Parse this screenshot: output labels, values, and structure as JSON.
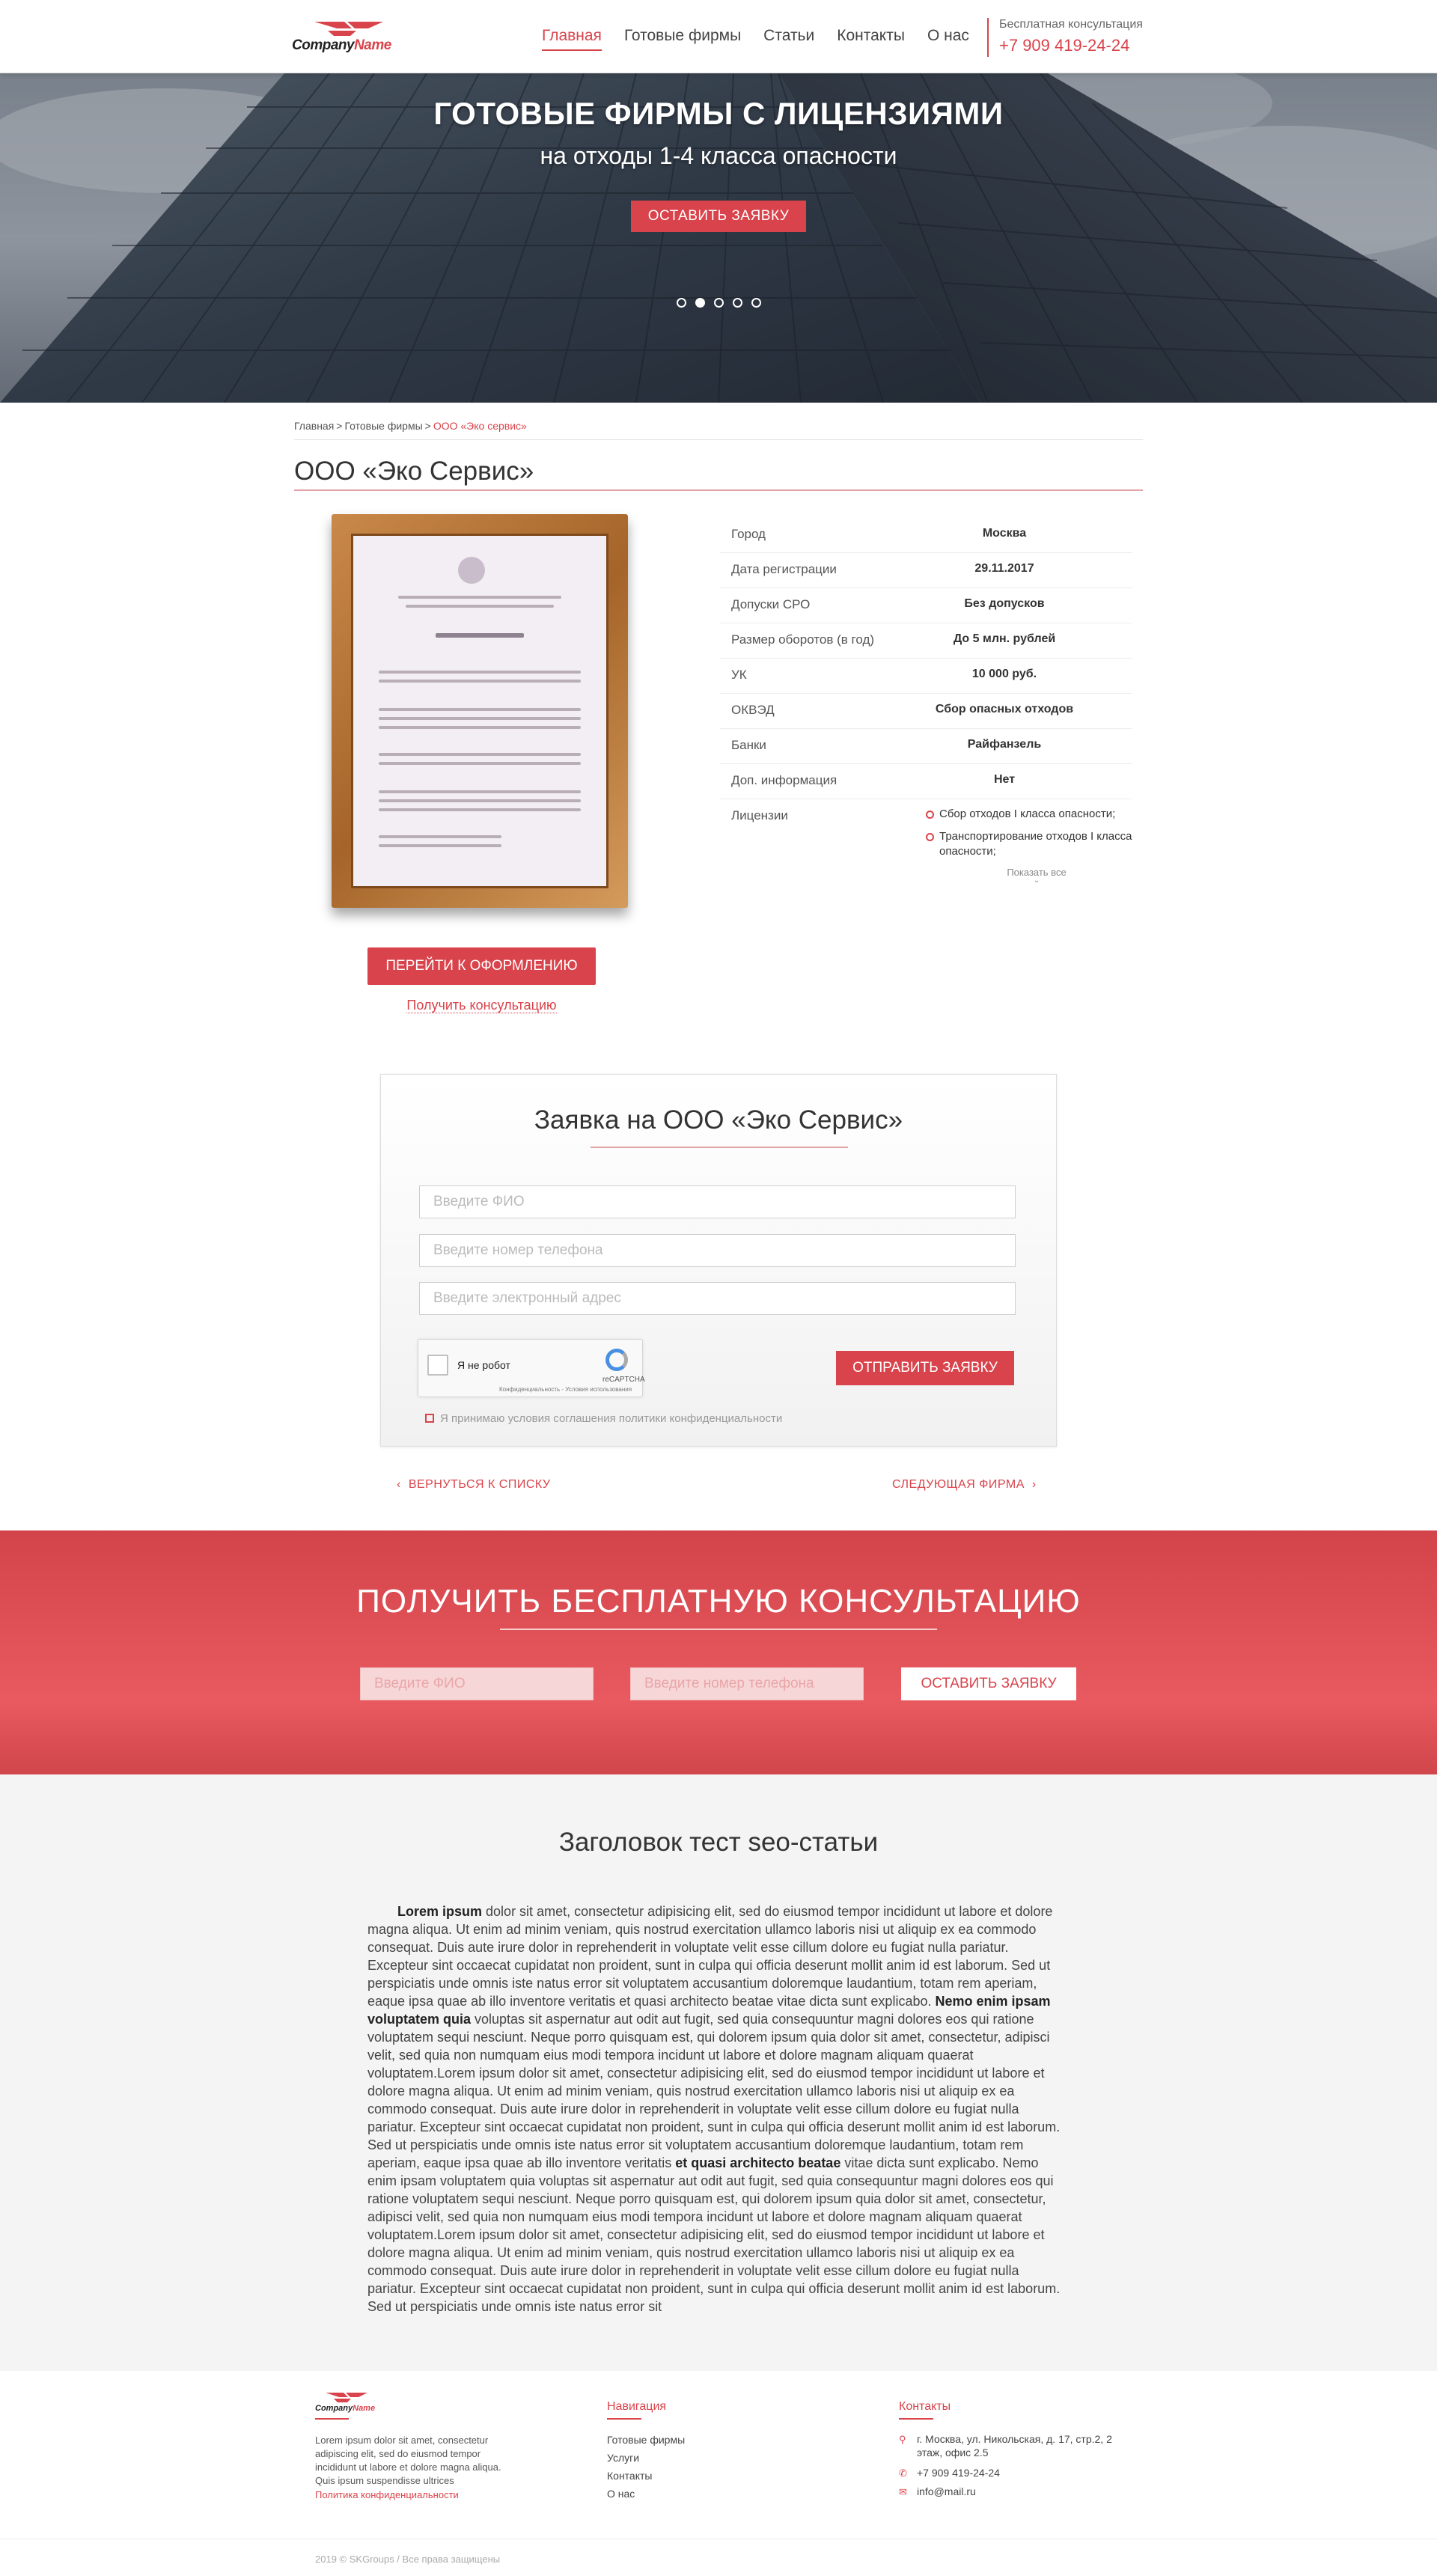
{
  "header": {
    "logo_prefix": "Company",
    "logo_suffix": "Name",
    "nav": [
      "Главная",
      "Готовые фирмы",
      "Статьи",
      "Контакты",
      "О нас"
    ],
    "consult_label": "Бесплатная консультация",
    "phone": "+7 909 419-24-24"
  },
  "hero": {
    "title": "ГОТОВЫЕ ФИРМЫ С ЛИЦЕНЗИЯМИ",
    "subtitle": "на отходы 1-4 класса опасности",
    "button": "ОСТАВИТЬ ЗАЯВКУ",
    "slides_total": 5,
    "slide_active": 2
  },
  "breadcrumbs": [
    "Главная",
    "Готовые фирмы",
    "ООО «Эко сервис»"
  ],
  "firm": {
    "title": "ООО «Эко Сервис»",
    "details": [
      {
        "key": "Город",
        "value": "Москва"
      },
      {
        "key": "Дата регистрации",
        "value": "29.11.2017"
      },
      {
        "key": "Допуски СРО",
        "value": "Без допусков"
      },
      {
        "key": "Размер оборотов (в год)",
        "value": "До 5 млн. рублей"
      },
      {
        "key": "УК",
        "value": "10 000 руб."
      },
      {
        "key": "ОКВЭД",
        "value": "Сбор опасных отходов"
      },
      {
        "key": "Банки",
        "value": "Райфанзель"
      },
      {
        "key": "Доп. информация",
        "value": "Нет"
      }
    ],
    "licenses_label": "Лицензии",
    "licenses": [
      "Сбор отходов I класса опасности;",
      "Транспортирование отходов I класса опасности;"
    ],
    "show_all": "Показать все",
    "go_button": "ПЕРЕЙТИ К ОФОРМЛЕНИЮ",
    "consult_link": "Получить консультацию"
  },
  "application": {
    "title": "Заявка на ООО «Эко Сервис»",
    "name_placeholder": "Введите ФИО",
    "phone_placeholder": "Введите номер телефона",
    "email_placeholder": "Введите электронный адрес",
    "captcha_label": "Я не робот",
    "captcha_brand": "reCAPTCHA",
    "captcha_terms": "Конфиденциальность - Условия использования",
    "submit": "ОТПРАВИТЬ ЗАЯВКУ",
    "agree": "Я принимаю условия соглашения политики конфиденциальности",
    "back": "ВЕРНУТЬСЯ К СПИСКУ",
    "next": "СЛЕДУЮЩАЯ ФИРМА"
  },
  "consult_band": {
    "title": "ПОЛУЧИТЬ БЕСПЛАТНУЮ КОНСУЛЬТАЦИЮ",
    "name_placeholder": "Введите ФИО",
    "phone_placeholder": "Введите номер телефона",
    "button": "ОСТАВИТЬ ЗАЯВКУ"
  },
  "seo": {
    "title": "Заголовок тест seo-статьи",
    "p1_bold": "Lorem ipsum",
    "p1": " dolor sit amet, consectetur adipisicing elit, sed do eiusmod tempor incididunt ut labore et dolore magna aliqua. Ut enim ad minim veniam, quis nostrud exercitation ullamco laboris nisi ut aliquip ex ea commodo consequat. Duis aute irure dolor in reprehenderit in voluptate velit esse cillum dolore eu fugiat nulla pariatur. Excepteur sint occaecat cupidatat non proident, sunt in culpa qui officia deserunt mollit anim id est laborum. Sed ut perspiciatis unde omnis iste natus error sit voluptatem accusantium doloremque laudantium, totam rem aperiam, eaque ipsa quae ab illo inventore veritatis et quasi architecto beatae vitae dicta sunt explicabo. ",
    "p2_bold": "Nemo enim ipsam voluptatem quia",
    "p2": " voluptas sit aspernatur aut odit aut fugit, sed quia consequuntur magni dolores eos qui ratione voluptatem sequi nesciunt. Neque porro quisquam est, qui dolorem ipsum quia dolor sit amet, consectetur, adipisci velit, sed quia non numquam eius modi tempora incidunt ut labore et dolore magnam aliquam quaerat voluptatem.Lorem ipsum dolor sit amet, consectetur adipisicing elit, sed do eiusmod tempor incididunt ut labore et dolore magna aliqua. Ut enim ad minim veniam, quis nostrud exercitation ullamco laboris nisi ut aliquip ex ea commodo consequat. Duis aute irure dolor in reprehenderit in voluptate velit esse cillum dolore eu fugiat nulla pariatur. Excepteur sint occaecat cupidatat non proident, sunt in culpa qui officia deserunt mollit anim id est laborum. Sed ut perspiciatis unde omnis iste natus error sit voluptatem accusantium doloremque laudantium, totam rem aperiam, eaque ipsa quae ab illo inventore veritatis ",
    "p3_bold": "et quasi architecto beatae",
    "p3": " vitae dicta sunt explicabo. Nemo enim ipsam voluptatem quia voluptas sit aspernatur aut odit aut fugit, sed quia consequuntur magni dolores eos qui ratione voluptatem sequi nesciunt. Neque porro quisquam est, qui dolorem ipsum quia dolor sit amet, consectetur, adipisci velit, sed quia non numquam eius modi tempora incidunt ut labore et dolore magnam aliquam quaerat voluptatem.Lorem ipsum dolor sit amet, consectetur adipisicing elit, sed do eiusmod tempor incididunt ut labore et dolore magna aliqua. Ut enim ad minim veniam, quis nostrud exercitation ullamco laboris nisi ut aliquip ex ea commodo consequat. Duis aute irure dolor in reprehenderit in voluptate velit esse cillum dolore eu fugiat nulla pariatur. Excepteur sint occaecat cupidatat non proident, sunt in culpa qui officia deserunt mollit anim id est laborum. Sed ut perspiciatis unde omnis iste natus error sit"
  },
  "footer": {
    "logo_prefix": "Company",
    "logo_suffix": "Name",
    "about": "Lorem ipsum dolor sit amet, consectetur adipiscing elit, sed do eiusmod tempor incididunt ut labore et dolore magna aliqua. Quis ipsum suspendisse ultrices",
    "privacy": "Политика конфиденциальности",
    "nav_title": "Навигация",
    "nav": [
      "Готовые фирмы",
      "Услуги",
      "Контакты",
      "О нас"
    ],
    "contacts_title": "Контакты",
    "address": "г. Москва, ул. Никольская, д. 17, стр.2, 2 этаж, офис 2.5",
    "phone": "+7 909 419-24-24",
    "email": "info@mail.ru",
    "copyright": "2019 © SKGroups / Все права защищены"
  },
  "colors": {
    "accent": "#d9434b",
    "band": "#e55a5f",
    "seo_bg": "#f4f4f4"
  }
}
